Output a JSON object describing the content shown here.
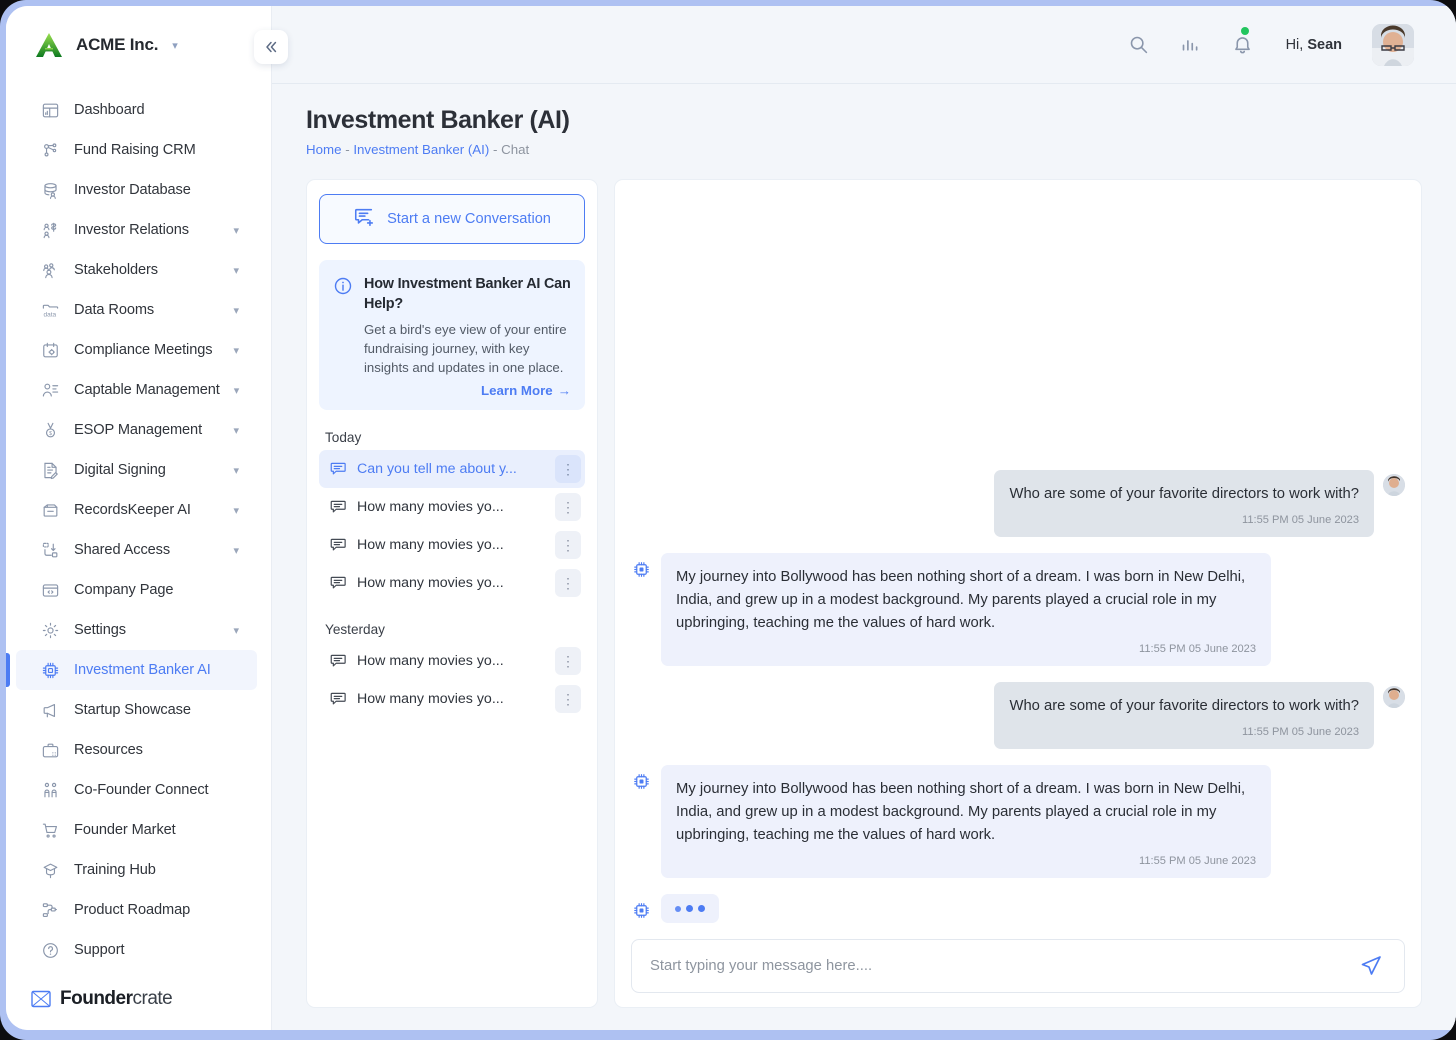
{
  "brand": {
    "name": "ACME Inc.",
    "caret": "chevron-down"
  },
  "sidebar": {
    "collapse_label": "«",
    "items": [
      {
        "label": "Dashboard",
        "icon": "dashboard-icon",
        "expandable": false,
        "active": false
      },
      {
        "label": "Fund Raising CRM",
        "icon": "network-icon",
        "expandable": false,
        "active": false
      },
      {
        "label": "Investor Database",
        "icon": "database-user-icon",
        "expandable": false,
        "active": false
      },
      {
        "label": "Investor Relations",
        "icon": "users-money-icon",
        "expandable": true,
        "active": false
      },
      {
        "label": "Stakeholders",
        "icon": "group-icon",
        "expandable": true,
        "active": false
      },
      {
        "label": "Data Rooms",
        "icon": "data-folder-icon",
        "expandable": true,
        "active": false
      },
      {
        "label": "Compliance Meetings",
        "icon": "calendar-gear-icon",
        "expandable": true,
        "active": false
      },
      {
        "label": "Captable Management",
        "icon": "user-list-icon",
        "expandable": true,
        "active": false
      },
      {
        "label": "ESOP Management",
        "icon": "medal-icon",
        "expandable": true,
        "active": false
      },
      {
        "label": "Digital Signing",
        "icon": "document-pen-icon",
        "expandable": true,
        "active": false
      },
      {
        "label": "RecordsKeeper AI",
        "icon": "archive-box-icon",
        "expandable": true,
        "active": false
      },
      {
        "label": "Shared Access",
        "icon": "share-arrows-icon",
        "expandable": true,
        "active": false
      },
      {
        "label": "Company Page",
        "icon": "browser-code-icon",
        "expandable": false,
        "active": false
      },
      {
        "label": "Settings",
        "icon": "gear-icon",
        "expandable": true,
        "active": false
      },
      {
        "label": "Investment Banker AI",
        "icon": "cpu-chip-icon",
        "expandable": false,
        "active": true
      },
      {
        "label": "Startup Showcase",
        "icon": "megaphone-icon",
        "expandable": false,
        "active": false
      },
      {
        "label": "Resources",
        "icon": "briefcase-icon",
        "expandable": false,
        "active": false
      },
      {
        "label": "Co-Founder Connect",
        "icon": "two-people-icon",
        "expandable": false,
        "active": false
      },
      {
        "label": "Founder Market",
        "icon": "cart-icon",
        "expandable": false,
        "active": false
      },
      {
        "label": "Training Hub",
        "icon": "graduation-cap-icon",
        "expandable": false,
        "active": false
      },
      {
        "label": "Product Roadmap",
        "icon": "roadmap-icon",
        "expandable": false,
        "active": false
      },
      {
        "label": "Support",
        "icon": "question-circle-icon",
        "expandable": false,
        "active": false
      }
    ],
    "footer_brand_bold": "Founder",
    "footer_brand_rest": "crate"
  },
  "topbar": {
    "search_icon": "search-icon",
    "analytics_icon": "bar-chart-icon",
    "notifications_icon": "bell-icon",
    "has_notification": true,
    "greeting_prefix": "Hi, ",
    "user_name": "Sean",
    "avatar": "user-avatar"
  },
  "page": {
    "title": "Investment Banker (AI)",
    "breadcrumb": {
      "home": "Home",
      "section": "Investment Banker (AI)",
      "separator": "-",
      "current": "Chat"
    }
  },
  "conversations_panel": {
    "new_conversation_label": "Start a new Conversation",
    "new_conversation_icon": "chat-plus-icon",
    "help": {
      "icon": "info-icon",
      "title": "How Investment Banker AI Can Help?",
      "body": "Get a bird's eye view of your entire fundraising journey, with key insights and updates in one place.",
      "link_label": "Learn More",
      "link_arrow": "→"
    },
    "groups": [
      {
        "label": "Today",
        "items": [
          {
            "title": "Can you tell me about y...",
            "active": true
          },
          {
            "title": "How many movies yo...",
            "active": false
          },
          {
            "title": "How many movies yo...",
            "active": false
          },
          {
            "title": "How many movies yo...",
            "active": false
          }
        ]
      },
      {
        "label": "Yesterday",
        "items": [
          {
            "title": "How many movies yo...",
            "active": false
          },
          {
            "title": "How many movies yo...",
            "active": false
          }
        ]
      }
    ]
  },
  "chat": {
    "messages": [
      {
        "sender": "user",
        "text": "Who are some of your favorite directors to work with?",
        "timestamp": "11:55 PM 05 June 2023"
      },
      {
        "sender": "ai",
        "text": "My journey into Bollywood has been nothing short of a dream. I was born in New Delhi, India, and grew up in a modest background. My parents played a crucial role in my upbringing, teaching me the values of hard work.",
        "timestamp": "11:55 PM 05 June 2023"
      },
      {
        "sender": "user",
        "text": "Who are some of your favorite directors to work with?",
        "timestamp": "11:55 PM 05 June 2023"
      },
      {
        "sender": "ai",
        "text": "My journey into Bollywood has been nothing short of a dream. I was born in New Delhi, India, and grew up in a modest background. My parents played a crucial role in my upbringing, teaching me the values of hard work.",
        "timestamp": "11:55 PM 05 June 2023"
      }
    ],
    "typing_indicator": true,
    "composer": {
      "placeholder": "Start typing your message here....",
      "value": "",
      "send_icon": "send-paper-plane-icon"
    }
  },
  "colors": {
    "accent": "#4d7cf3",
    "frame": "#aec1f2",
    "content_bg": "#f3f6fa",
    "user_bubble": "#dfe4ea",
    "ai_bubble": "#eef1fc",
    "status_dot": "#22c55e"
  }
}
